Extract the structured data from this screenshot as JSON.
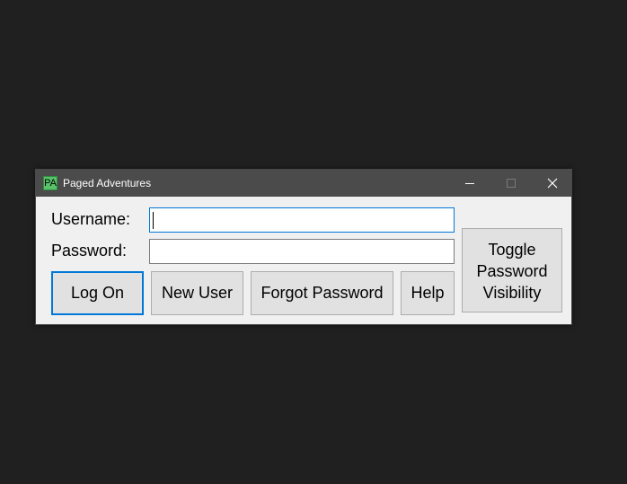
{
  "window": {
    "title": "Paged Adventures",
    "icon_text": "PA",
    "icon_color": "#58c36a",
    "controls": {
      "minimize": "minimize-icon",
      "maximize": "maximize-icon",
      "close": "close-icon"
    }
  },
  "form": {
    "username_label": "Username:",
    "password_label": "Password:",
    "username_value": "",
    "password_value": ""
  },
  "buttons": {
    "log_on": "Log On",
    "new_user": "New User",
    "forgot_password": "Forgot Password",
    "help": "Help",
    "toggle_line1": "Toggle",
    "toggle_line2": "Password",
    "toggle_line3": "Visibility"
  },
  "colors": {
    "accent": "#0078d7",
    "titlebar": "#4b4b4b",
    "desktop": "#202020"
  }
}
